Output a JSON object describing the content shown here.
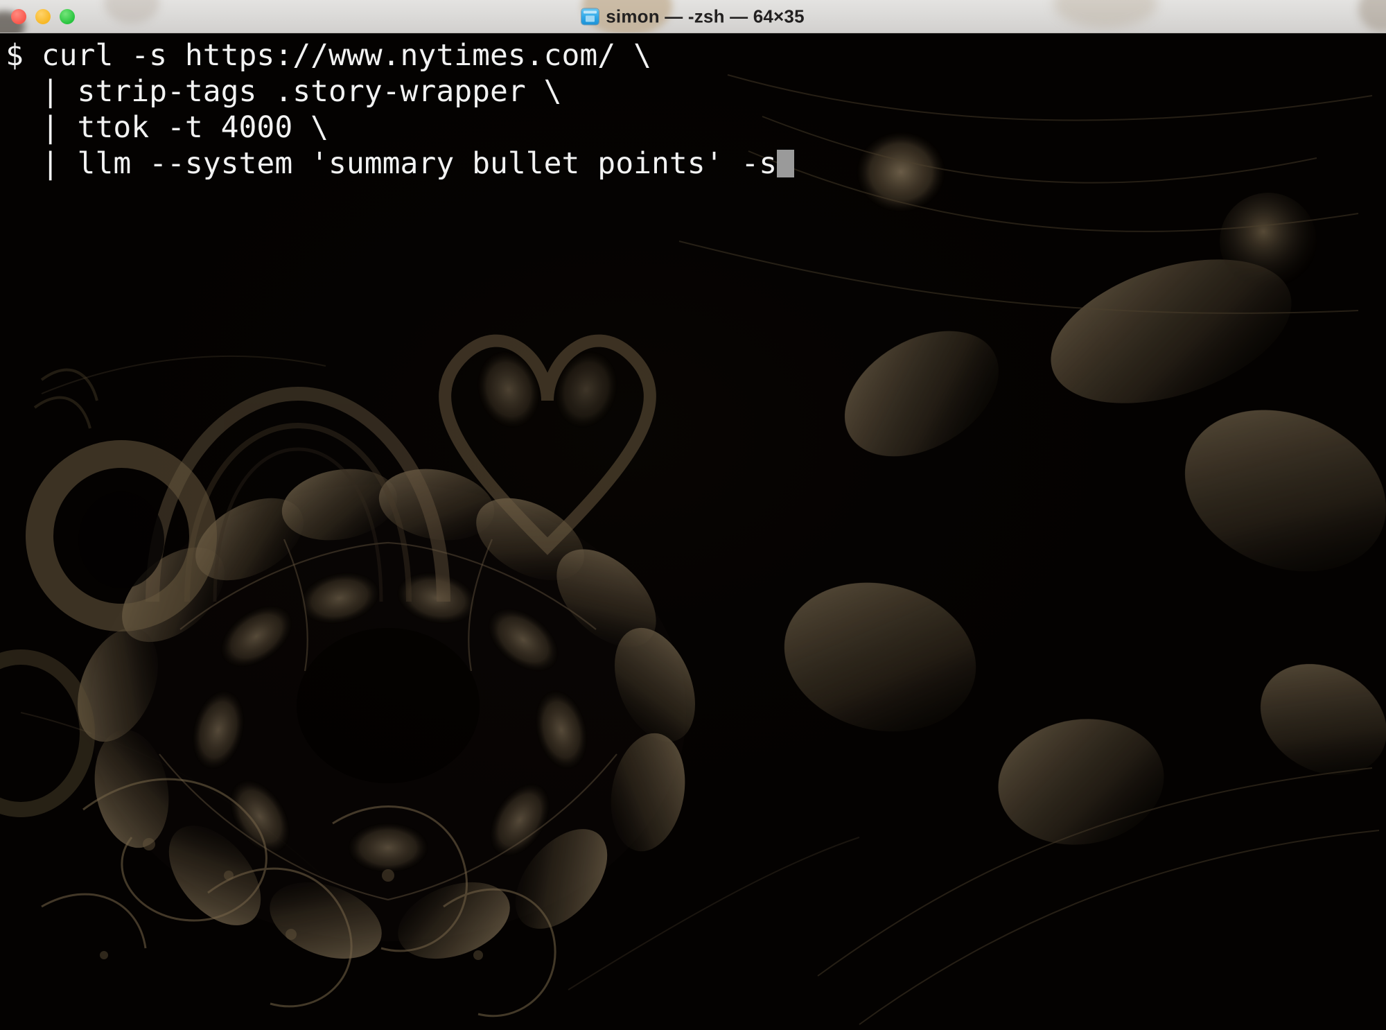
{
  "window": {
    "title": "simon — -zsh — 64×35",
    "icon": "terminal-app-icon",
    "controls": {
      "close_label": "",
      "minimize_label": "",
      "maximize_label": ""
    },
    "colors": {
      "titlebar_bg": "#dbdad8",
      "title_text": "#222020",
      "close": "#f9574c",
      "minimize": "#f7b725",
      "maximize": "#27c33d",
      "terminal_bg": "#080503",
      "terminal_fg": "#f2f2f2",
      "cursor": "#9a9a9a"
    },
    "size": "64×35",
    "shell": "-zsh",
    "user": "simon"
  },
  "terminal": {
    "lines": [
      "$ curl -s https://www.nytimes.com/ \\",
      "  | strip-tags .story-wrapper \\",
      "  | ttok -t 4000 \\",
      "  | llm --system 'summary bullet points' -s"
    ],
    "prompt": "$",
    "cursor_visible": true
  }
}
